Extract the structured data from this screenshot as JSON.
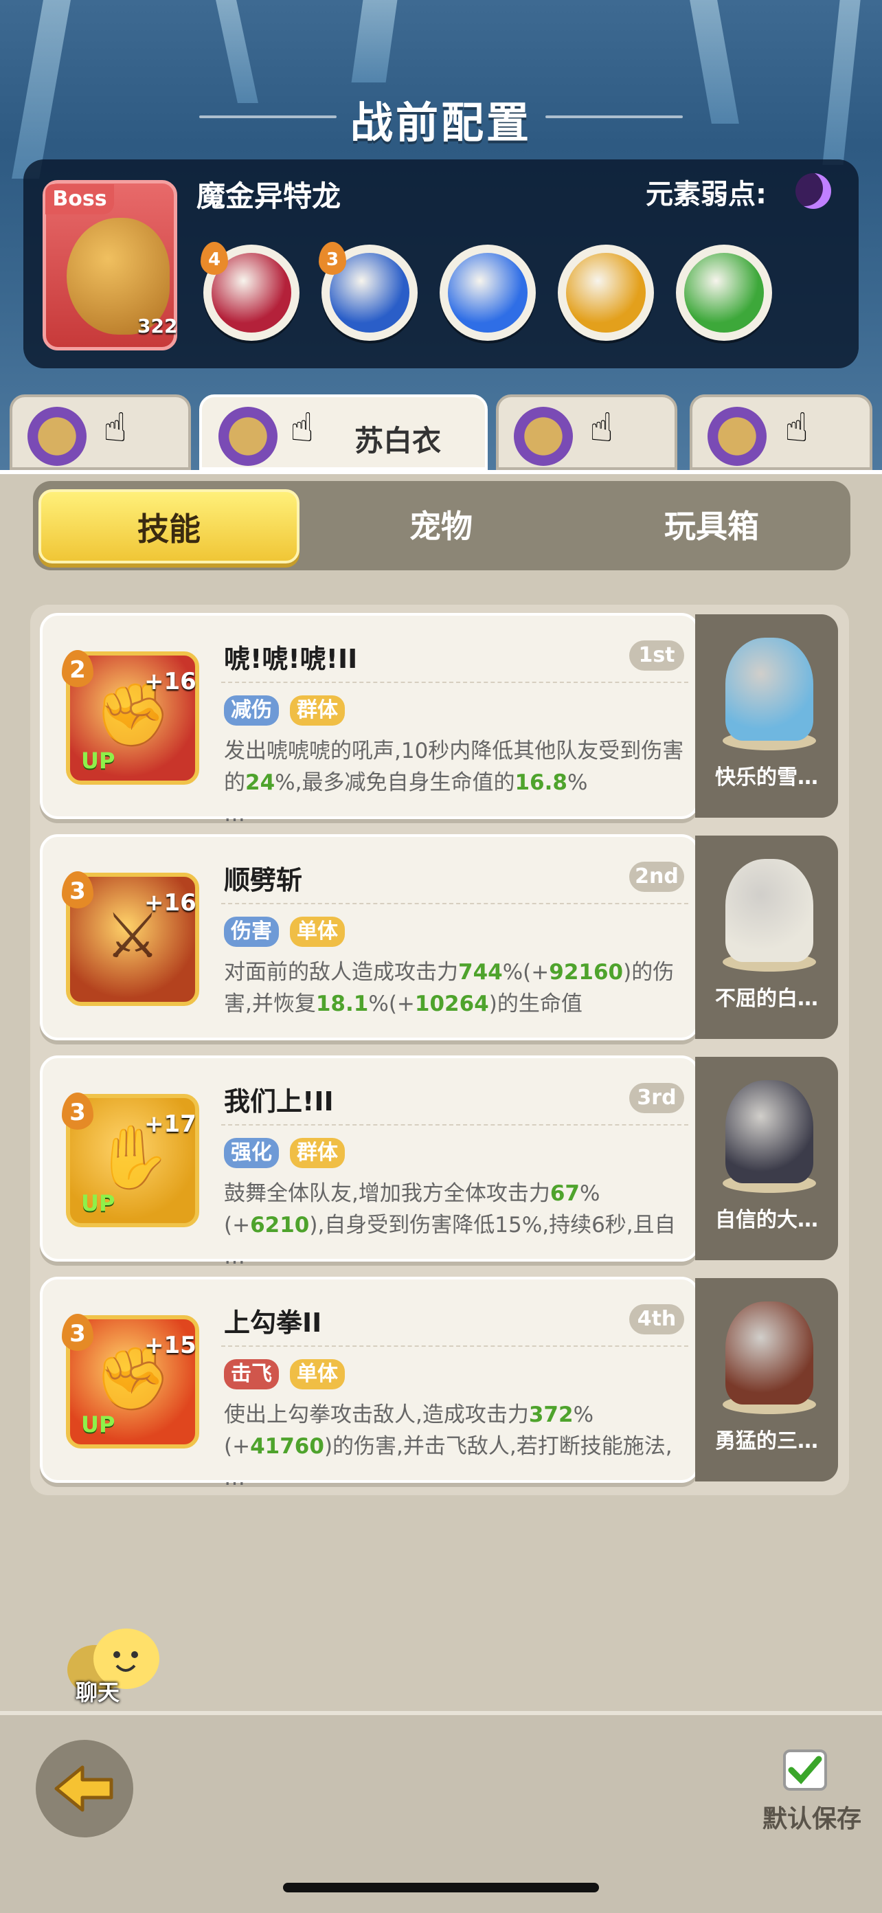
{
  "screen": {
    "title": "战前配置"
  },
  "boss": {
    "tag": "Boss",
    "name": "魔金异特龙",
    "level": "322",
    "weakness_label": "元素弱点:",
    "weakness_icon": "moon-icon",
    "skills": [
      {
        "icon": "fang-bite-icon",
        "level_badge": "4",
        "color": "#b4213a"
      },
      {
        "icon": "lightning-strike-icon",
        "level_badge": "3",
        "color": "#2a5ec8"
      },
      {
        "icon": "lightning-bolt-icon",
        "level_badge": "",
        "color": "#2f6ee6"
      },
      {
        "icon": "golden-crown-icon",
        "level_badge": "",
        "color": "#e3a01c"
      },
      {
        "icon": "green-slime-icon",
        "level_badge": "",
        "color": "#3da83a"
      }
    ]
  },
  "character_tabs": [
    {
      "label": "",
      "active": false
    },
    {
      "label": "苏白衣",
      "active": true
    },
    {
      "label": "",
      "active": false
    },
    {
      "label": "",
      "active": false
    }
  ],
  "segments": [
    {
      "label": "技能",
      "active": true
    },
    {
      "label": "宠物",
      "active": false
    },
    {
      "label": "玩具箱",
      "active": false
    }
  ],
  "skills": [
    {
      "name": "唬!唬!唬!II",
      "order": "1st",
      "level": "2",
      "bonus": "+16",
      "up": "UP",
      "tags": [
        {
          "text": "减伤",
          "style": "blue"
        },
        {
          "text": "群体",
          "style": "yel"
        }
      ],
      "desc_parts": [
        "发出唬唬唬的吼声,10秒内降低其他队友受到伤害的",
        "24",
        "%,最多减免自身生命值的",
        "16.8",
        "%",
        "…"
      ],
      "icon_color": "#c9352a",
      "pet": {
        "name": "快乐的雪…",
        "color": "#6fb7e0"
      }
    },
    {
      "name": "顺劈斩",
      "order": "2nd",
      "level": "3",
      "bonus": "+16",
      "up": "",
      "tags": [
        {
          "text": "伤害",
          "style": "blue"
        },
        {
          "text": "单体",
          "style": "yel"
        }
      ],
      "desc_parts": [
        "对面前的敌人造成攻击力",
        "744",
        "%(+",
        "92160",
        ")的伤害,并恢复",
        "18.1",
        "%(+",
        "10264",
        ")的生命值"
      ],
      "icon_color": "#b4421e",
      "pet": {
        "name": "不屈的白…",
        "color": "#e9e6dc"
      }
    },
    {
      "name": "我们上!II",
      "order": "3rd",
      "level": "3",
      "bonus": "+17",
      "up": "UP",
      "tags": [
        {
          "text": "强化",
          "style": "blue"
        },
        {
          "text": "群体",
          "style": "yel"
        }
      ],
      "desc_parts": [
        "鼓舞全体队友,增加我方全体攻击力",
        "67",
        "%(+",
        "6210",
        "),自身受到伤害降低15%,持续6秒,且自",
        "…"
      ],
      "icon_color": "#e3a11b",
      "pet": {
        "name": "自信的大…",
        "color": "#3c3c4a"
      }
    },
    {
      "name": "上勾拳II",
      "order": "4th",
      "level": "3",
      "bonus": "+15",
      "up": "UP",
      "tags": [
        {
          "text": "击飞",
          "style": "red"
        },
        {
          "text": "单体",
          "style": "yel"
        }
      ],
      "desc_parts": [
        "使出上勾拳攻击敌人,造成攻击力",
        "372",
        "%(+",
        "41760",
        ")的伤害,并击飞敌人,若打断技能施法,",
        "…"
      ],
      "icon_color": "#e0461e",
      "pet": {
        "name": "勇猛的三…",
        "color": "#7a3a2a"
      }
    }
  ],
  "chat": {
    "label": "聊天"
  },
  "footer": {
    "save_label": "默认保存",
    "back_icon": "back-arrow-icon"
  }
}
